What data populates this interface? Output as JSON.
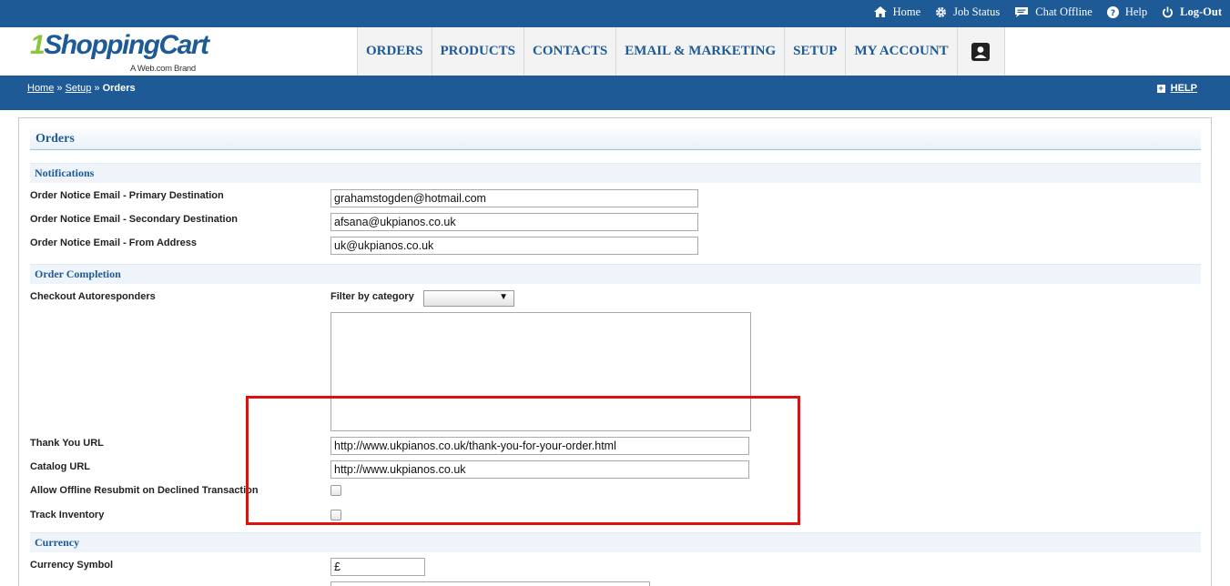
{
  "topnav": {
    "home": "Home",
    "job_status": "Job Status",
    "chat": "Chat Offline",
    "help": "Help",
    "logout": "Log-Out"
  },
  "logo": {
    "one": "1",
    "name": "ShoppingCart",
    "tagline": "A Web.com Brand"
  },
  "mainnav": [
    "ORDERS",
    "PRODUCTS",
    "CONTACTS",
    "EMAIL & MARKETING",
    "SETUP",
    "MY ACCOUNT"
  ],
  "breadcrumb": {
    "home": "Home",
    "sep": "»",
    "setup": "Setup",
    "current": "Orders"
  },
  "help_link": "HELP",
  "page_title": "Orders",
  "notifications": {
    "heading": "Notifications",
    "primary_label": "Order Notice Email - Primary Destination",
    "primary_value": "grahamstogden@hotmail.com",
    "secondary_label": "Order Notice Email - Secondary Destination",
    "secondary_value": "afsana@ukpianos.co.uk",
    "from_label": "Order Notice Email - From Address",
    "from_value": "uk@ukpianos.co.uk"
  },
  "order_completion": {
    "heading": "Order Completion",
    "autoresponders_label": "Checkout Autoresponders",
    "filter_label": "Filter by category",
    "filter_value": "",
    "thankyou_label": "Thank You URL",
    "thankyou_value": "http://www.ukpianos.co.uk/thank-you-for-your-order.html",
    "catalog_label": "Catalog URL",
    "catalog_value": "http://www.ukpianos.co.uk",
    "resubmit_label": "Allow Offline Resubmit on Declined Transaction",
    "resubmit_checked": false,
    "inventory_label": "Track Inventory",
    "inventory_checked": false
  },
  "currency": {
    "heading": "Currency",
    "symbol_label": "Currency Symbol",
    "symbol_value": "£"
  },
  "colors": {
    "brand_blue": "#1d5a96",
    "brand_green": "#8cc63f",
    "highlight_red": "#e01010"
  }
}
